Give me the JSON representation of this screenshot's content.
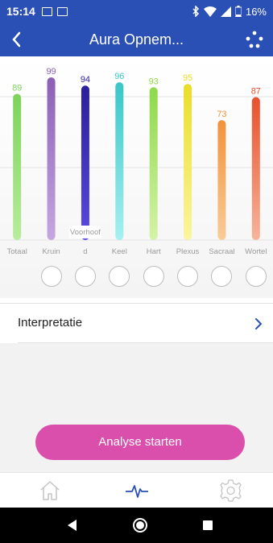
{
  "status_bar": {
    "time": "15:14",
    "battery": "16%",
    "icons": [
      "image-icon",
      "mail-icon",
      "bluetooth-icon",
      "wifi-icon",
      "signal-icon",
      "battery-icon"
    ]
  },
  "header": {
    "title": "Aura Opnem...",
    "back_icon": "back-chevron-icon",
    "menu_icon": "dots-menu-icon",
    "color": "#2a4fb5"
  },
  "chart_data": {
    "type": "bar",
    "categories": [
      "Totaal",
      "Kruin",
      "Voorhoofd",
      "Keel",
      "Hart",
      "Plexus",
      "Sacraal",
      "Wortel"
    ],
    "category_labels_shown": [
      "Totaal",
      "Kruin",
      "d",
      "Keel",
      "Hart",
      "Plexus",
      "Sacraal",
      "Wortel"
    ],
    "voorhoofd_overlay_label": "Voorhoof",
    "values": [
      89,
      99,
      94,
      96,
      93,
      95,
      73,
      87
    ],
    "bar_colors_top": [
      "#7cd35b",
      "#8b5fb4",
      "#2a1f9c",
      "#39c6c8",
      "#8fd94a",
      "#eadd2a",
      "#f0933b",
      "#e8502c"
    ],
    "bar_colors_bottom": [
      "#b9ec9c",
      "#c4a7e0",
      "#5a4be0",
      "#a6f0f0",
      "#d4f3a8",
      "#fbf59e",
      "#f8cc98",
      "#f6b49a"
    ],
    "ylim": [
      0,
      100
    ],
    "grid": true
  },
  "interpretation": {
    "label": "Interpretatie"
  },
  "actions": {
    "start_label": "Analyse starten",
    "start_color": "#d94fab"
  },
  "bottom_nav": {
    "items": [
      "home-icon",
      "pulse-icon",
      "settings-gear-icon"
    ],
    "active_color": "#2a4fb5",
    "inactive_color": "#c4c4c4"
  },
  "android_nav": [
    "back-triangle-icon",
    "home-circle-icon",
    "recents-square-icon"
  ]
}
